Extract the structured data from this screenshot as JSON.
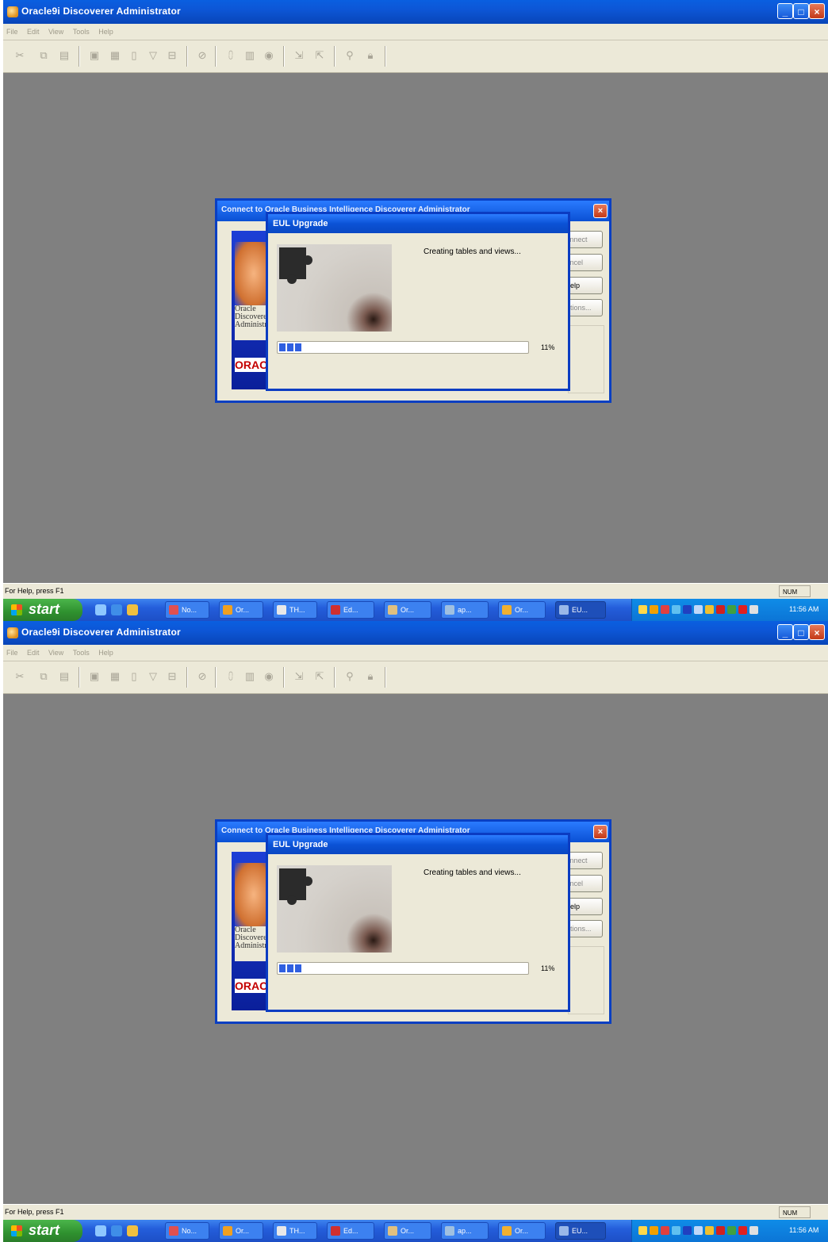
{
  "app": {
    "title": "Oracle9i Discoverer Administrator",
    "menu": [
      "File",
      "Edit",
      "View",
      "Tools",
      "Help"
    ],
    "toolbar_icons": [
      "cut-icon",
      "copy-icon",
      "paste-icon",
      "new-folder-icon",
      "properties-icon",
      "item-icon",
      "filter-icon",
      "join-icon",
      "hierarchy-icon",
      "summary-icon",
      "calendar-icon",
      "database-icon",
      "import-icon",
      "export-icon",
      "find-icon",
      "lock-icon"
    ]
  },
  "status_bar": {
    "left": "For Help, press F1",
    "num": "NUM"
  },
  "taskbar": {
    "start_label": "start",
    "tasks": [
      "No...",
      "Or...",
      "TH...",
      "Ed...",
      "Or...",
      "ap...",
      "Or...",
      "EU..."
    ],
    "clock": "11:56 AM"
  },
  "connect_dialog": {
    "title": "Connect to Oracle Business Intelligence Discoverer Administrator",
    "banner_text": "Oracle Discoverer Administrator",
    "logo": "ORACLE",
    "buttons": [
      "Connect",
      "Cancel",
      "Help",
      "Options..."
    ]
  },
  "eul_dialog": {
    "title": "EUL Upgrade",
    "status": "Creating tables and views...",
    "progress_text": "11%",
    "progress": 0.11
  },
  "colors": {
    "titlebar": "#0a5fe0",
    "desktop": "#808080",
    "dialog_face": "#ece9d8",
    "progress": "#2f5fe0",
    "start_green": "#2f912f"
  }
}
